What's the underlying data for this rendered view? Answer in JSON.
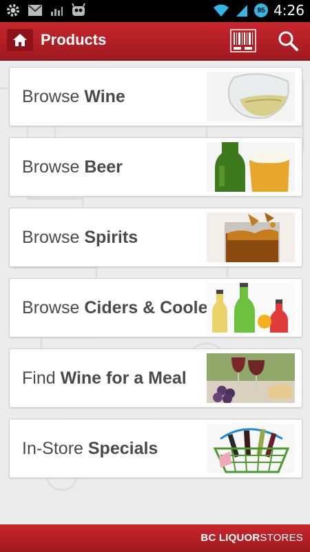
{
  "status_bar": {
    "time": "4:26",
    "battery_level": "95"
  },
  "action_bar": {
    "title": "Products"
  },
  "cards": [
    {
      "prefix": "Browse ",
      "emphasis": "Wine"
    },
    {
      "prefix": "Browse ",
      "emphasis": "Beer"
    },
    {
      "prefix": "Browse ",
      "emphasis": "Spirits"
    },
    {
      "prefix": "Browse ",
      "emphasis": "Ciders & Coolers"
    },
    {
      "prefix": "Find ",
      "emphasis": "Wine for a Meal"
    },
    {
      "prefix": "In-Store ",
      "emphasis": "Specials"
    }
  ],
  "footer": {
    "brand_bold": "BC LIQUOR",
    "brand_regular": "STORES"
  },
  "colors": {
    "brand_red": "#c8262c",
    "status_accent": "#33b5e5"
  }
}
